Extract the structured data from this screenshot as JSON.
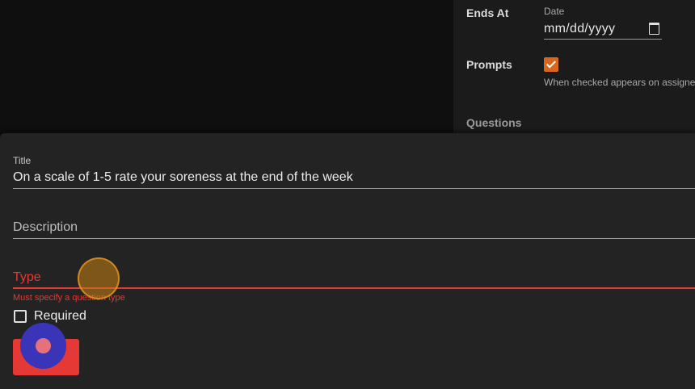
{
  "background_form": {
    "ends_at": {
      "label": "Ends At",
      "sublabel": "Date",
      "value": "mm/dd/yyyy",
      "icon": "calendar-icon"
    },
    "prompts": {
      "label": "Prompts",
      "checked": true,
      "hint": "When checked appears on assigne",
      "checkbox_color": "#d9661f"
    },
    "questions_label": "Questions"
  },
  "dialog": {
    "title_field": {
      "label": "Title",
      "value": "On a scale of 1-5 rate your soreness at the end of the week"
    },
    "description_field": {
      "placeholder": "Description"
    },
    "type_field": {
      "placeholder": "Type",
      "error": "Must specify a question type",
      "error_color": "#e53935"
    },
    "required": {
      "label": "Required",
      "checked": false
    },
    "save_button": {
      "label": "Save",
      "color": "#e53935"
    }
  }
}
